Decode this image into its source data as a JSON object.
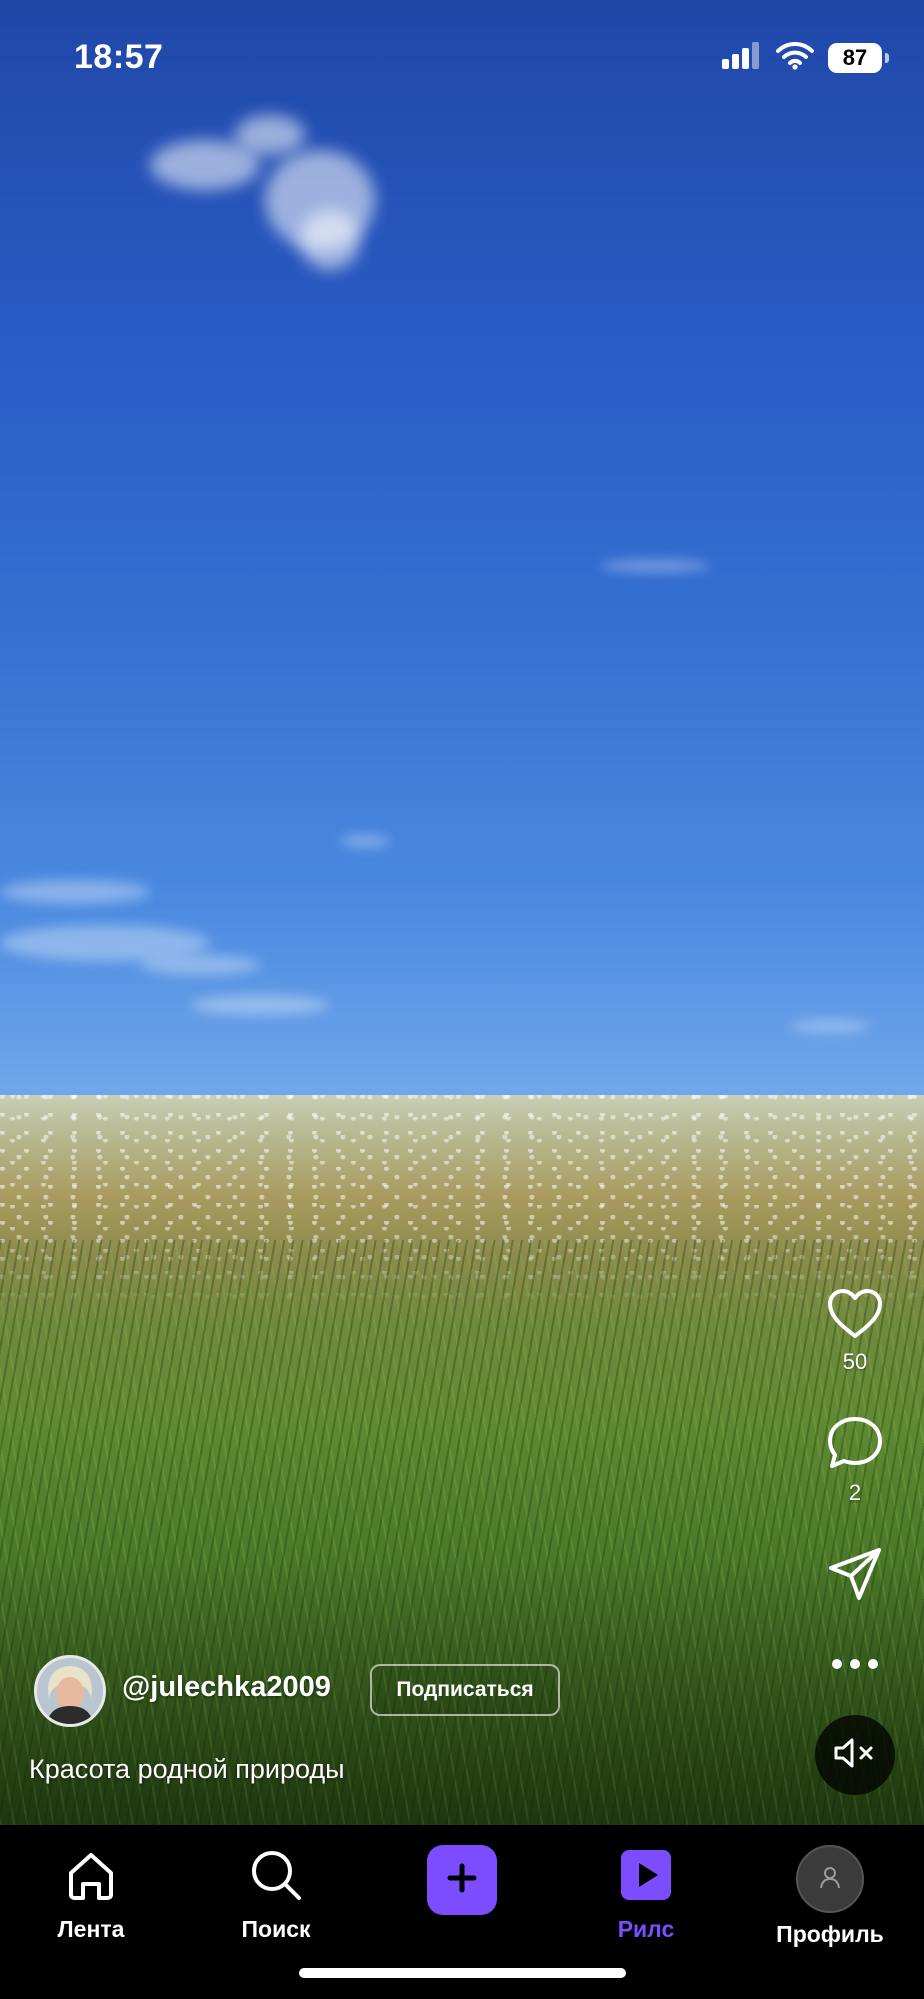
{
  "status_bar": {
    "time": "18:57",
    "battery": "87",
    "icons": [
      "signal-icon",
      "wifi-icon",
      "battery-icon"
    ]
  },
  "post": {
    "username": "@julechka2009",
    "subscribe_label": "Подписаться",
    "caption": "Красота родной природы",
    "likes": "50",
    "comments": "2"
  },
  "actions": {
    "icons": [
      "heart-icon",
      "comment-icon",
      "share-icon",
      "more-icon",
      "mute-icon"
    ]
  },
  "tabs": {
    "feed": "Лента",
    "search": "Поиск",
    "reels": "Рилс",
    "profile": "Профиль"
  },
  "colors": {
    "accent": "#7c4dff",
    "tabbar_bg": "#000000"
  }
}
